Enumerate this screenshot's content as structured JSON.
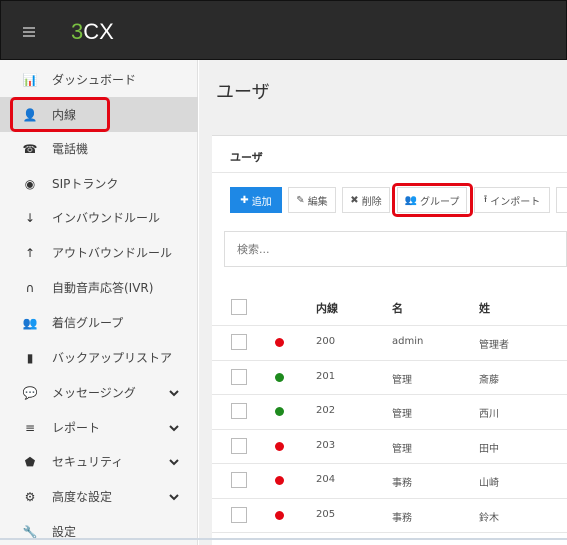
{
  "app": {
    "logo_prefix": "3",
    "logo_suffix": "CX"
  },
  "sidebar": {
    "items": [
      {
        "label": "ダッシュボード",
        "icon": "bar-chart-icon",
        "glyph": "📊",
        "chevron": false,
        "active": false
      },
      {
        "label": "内線",
        "icon": "user-icon",
        "glyph": "👤",
        "chevron": false,
        "active": true
      },
      {
        "label": "電話機",
        "icon": "phone-icon",
        "glyph": "☎",
        "chevron": false,
        "active": false
      },
      {
        "label": "SIPトランク",
        "icon": "globe-icon",
        "glyph": "◉",
        "chevron": false,
        "active": false
      },
      {
        "label": "インバウンドルール",
        "icon": "arrow-down-icon",
        "glyph": "↓",
        "chevron": false,
        "active": false
      },
      {
        "label": "アウトバウンドルール",
        "icon": "arrow-up-icon",
        "glyph": "↑",
        "chevron": false,
        "active": false
      },
      {
        "label": "自動音声応答(IVR)",
        "icon": "headset-icon",
        "glyph": "∩",
        "chevron": false,
        "active": false
      },
      {
        "label": "着信グループ",
        "icon": "group-icon",
        "glyph": "👥",
        "chevron": false,
        "active": false
      },
      {
        "label": "バックアップリストア",
        "icon": "database-icon",
        "glyph": "▮",
        "chevron": false,
        "active": false
      },
      {
        "label": "メッセージング",
        "icon": "chat-icon",
        "glyph": "💬",
        "chevron": true,
        "active": false
      },
      {
        "label": "レポート",
        "icon": "list-icon",
        "glyph": "≡",
        "chevron": true,
        "active": false
      },
      {
        "label": "セキュリティ",
        "icon": "shield-icon",
        "glyph": "⬟",
        "chevron": true,
        "active": false
      },
      {
        "label": "高度な設定",
        "icon": "gear-icon",
        "glyph": "⚙",
        "chevron": true,
        "active": false
      },
      {
        "label": "設定",
        "icon": "wrench-icon",
        "glyph": "🔧",
        "chevron": false,
        "active": false
      }
    ]
  },
  "main": {
    "page_title": "ユーザ",
    "card_title": "ユーザ",
    "toolbar": {
      "add_label": "追加",
      "edit_label": "編集",
      "delete_label": "削除",
      "group_label": "グループ",
      "import_label": "インポート"
    },
    "search_placeholder": "検索...",
    "table": {
      "columns": [
        "内線",
        "名",
        "姓"
      ],
      "rows": [
        {
          "ext": "200",
          "first": "admin",
          "last": "管理者",
          "status_color": "#e30613"
        },
        {
          "ext": "201",
          "first": "管理",
          "last": "斎藤",
          "status_color": "#1e8a1e"
        },
        {
          "ext": "202",
          "first": "管理",
          "last": "西川",
          "status_color": "#1e8a1e"
        },
        {
          "ext": "203",
          "first": "管理",
          "last": "田中",
          "status_color": "#e30613"
        },
        {
          "ext": "204",
          "first": "事務",
          "last": "山崎",
          "status_color": "#e30613"
        },
        {
          "ext": "205",
          "first": "事務",
          "last": "鈴木",
          "status_color": "#e30613"
        }
      ]
    }
  },
  "colors": {
    "accent": "#1e88e5",
    "highlight": "#e30613",
    "online": "#1e8a1e",
    "offline": "#e30613"
  }
}
